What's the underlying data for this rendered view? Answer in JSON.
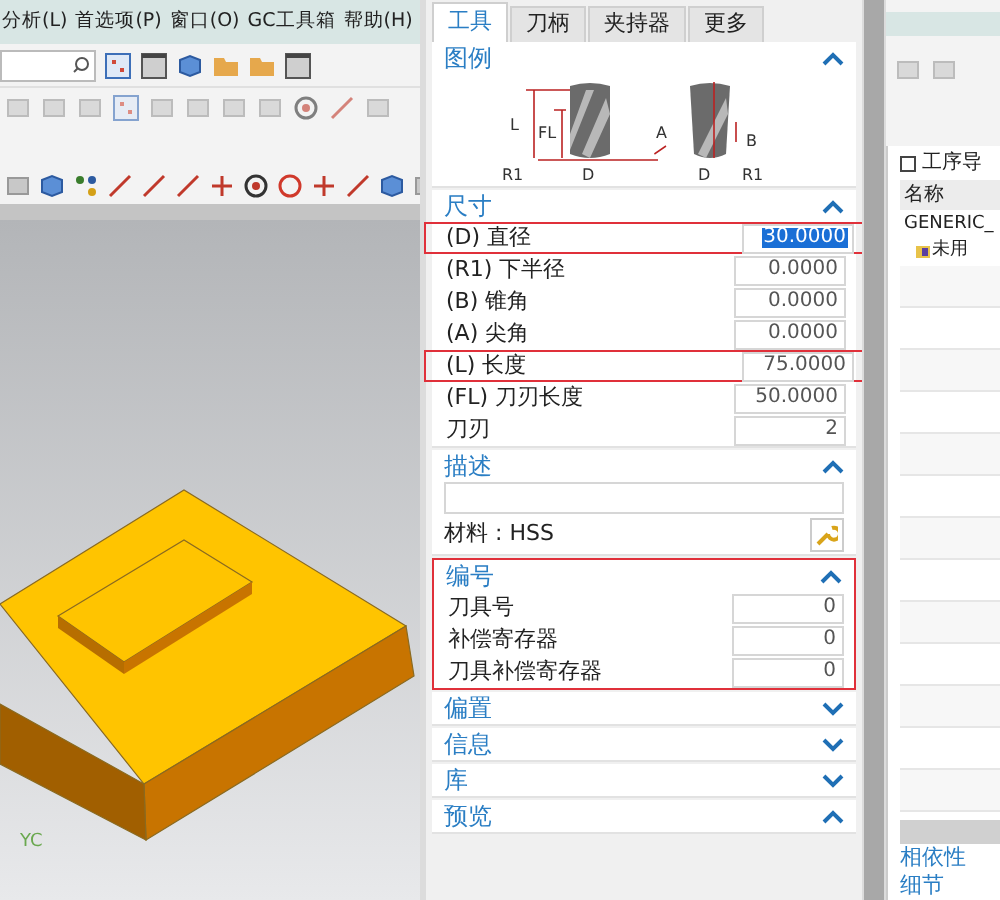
{
  "menu_bar": [
    "分析(L)",
    "首选项(P)",
    "窗口(O)",
    "GC工具箱",
    "帮助(H)"
  ],
  "viewport": {
    "axis_label": "YC"
  },
  "dialog": {
    "tabs": [
      {
        "label": "工具",
        "selected": true
      },
      {
        "label": "刀柄",
        "selected": false
      },
      {
        "label": "夹持器",
        "selected": false
      },
      {
        "label": "更多",
        "selected": false
      }
    ],
    "sections": [
      {
        "kind": "legend",
        "title": "图例",
        "expanded": true,
        "labels": [
          "L",
          "FL",
          "A",
          "B",
          "R1",
          "D",
          "D",
          "R1"
        ]
      },
      {
        "kind": "fields",
        "title": "尺寸",
        "expanded": true,
        "highlighted": false,
        "rows": [
          {
            "label": "(D) 直径",
            "value": "30.0000",
            "selected": true,
            "highlighted": true
          },
          {
            "label": "(R1) 下半径",
            "value": "0.0000",
            "selected": false,
            "highlighted": false
          },
          {
            "label": "(B) 锥角",
            "value": "0.0000",
            "selected": false,
            "highlighted": false
          },
          {
            "label": "(A) 尖角",
            "value": "0.0000",
            "selected": false,
            "highlighted": false
          },
          {
            "label": "(L) 长度",
            "value": "75.0000",
            "selected": false,
            "highlighted": true
          },
          {
            "label": "(FL) 刀刃长度",
            "value": "50.0000",
            "selected": false,
            "highlighted": false
          },
          {
            "label": "刀刃",
            "value": "2",
            "selected": false,
            "highlighted": false
          }
        ]
      },
      {
        "kind": "description",
        "title": "描述",
        "expanded": true,
        "material": "材料 : HSS"
      },
      {
        "kind": "fields",
        "title": "编号",
        "expanded": true,
        "highlighted": true,
        "rows": [
          {
            "label": "刀具号",
            "value": "0",
            "selected": false,
            "highlighted": false
          },
          {
            "label": "补偿寄存器",
            "value": "0",
            "selected": false,
            "highlighted": false
          },
          {
            "label": "刀具补偿寄存器",
            "value": "0",
            "selected": false,
            "highlighted": false
          }
        ]
      },
      {
        "kind": "collapsed",
        "title": "偏置",
        "expanded": false
      },
      {
        "kind": "collapsed",
        "title": "信息",
        "expanded": false
      },
      {
        "kind": "collapsed",
        "title": "库",
        "expanded": false
      },
      {
        "kind": "preview",
        "title": "预览",
        "expanded": true
      }
    ]
  },
  "navigator": {
    "title": "工序导",
    "column": "名称",
    "rows": [
      {
        "label": "GENERIC_",
        "children": [
          {
            "label": "未用"
          }
        ]
      }
    ],
    "bottom_sections": [
      "相依性",
      "细节"
    ]
  }
}
